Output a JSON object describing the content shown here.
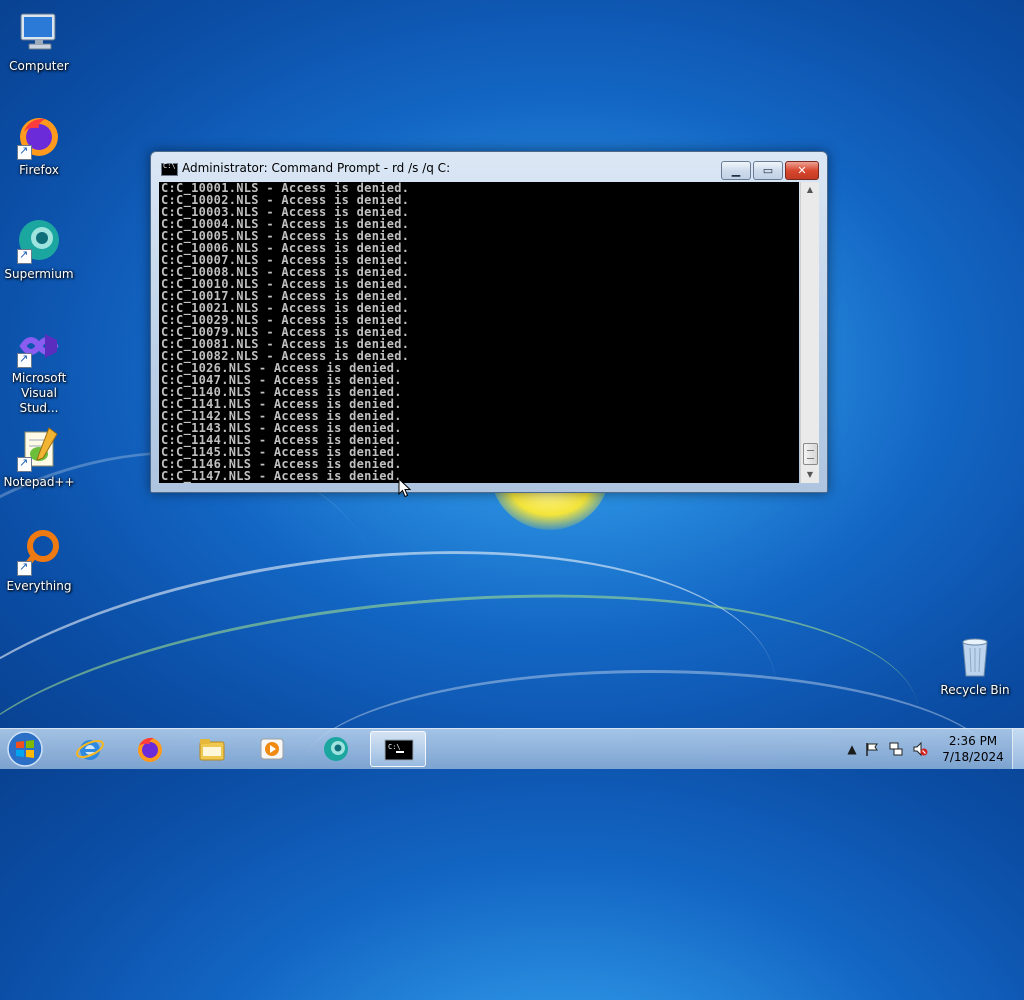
{
  "desktop": {
    "icons": [
      {
        "label": "Computer",
        "icon": "computer-icon"
      },
      {
        "label": "Firefox",
        "icon": "firefox-icon"
      },
      {
        "label": "Supermium",
        "icon": "supermium-icon"
      },
      {
        "label": "Microsoft Visual Stud...",
        "icon": "visual-studio-icon"
      },
      {
        "label": "Notepad++",
        "icon": "notepadpp-icon"
      },
      {
        "label": "Everything",
        "icon": "everything-icon"
      },
      {
        "label": "Recycle Bin",
        "icon": "recycle-bin-icon"
      }
    ]
  },
  "window": {
    "title": "Administrator:  Command Prompt - rd  /s /q C:",
    "icon": "cmd-icon",
    "buttons": {
      "minimize": "minimize-icon",
      "maximize": "maximize-icon",
      "close": "close-icon"
    },
    "console_lines": [
      "C:C_10001.NLS - Access is denied.",
      "C:C_10002.NLS - Access is denied.",
      "C:C_10003.NLS - Access is denied.",
      "C:C_10004.NLS - Access is denied.",
      "C:C_10005.NLS - Access is denied.",
      "C:C_10006.NLS - Access is denied.",
      "C:C_10007.NLS - Access is denied.",
      "C:C_10008.NLS - Access is denied.",
      "C:C_10010.NLS - Access is denied.",
      "C:C_10017.NLS - Access is denied.",
      "C:C_10021.NLS - Access is denied.",
      "C:C_10029.NLS - Access is denied.",
      "C:C_10079.NLS - Access is denied.",
      "C:C_10081.NLS - Access is denied.",
      "C:C_10082.NLS - Access is denied.",
      "C:C_1026.NLS - Access is denied.",
      "C:C_1047.NLS - Access is denied.",
      "C:C_1140.NLS - Access is denied.",
      "C:C_1141.NLS - Access is denied.",
      "C:C_1142.NLS - Access is denied.",
      "C:C_1143.NLS - Access is denied.",
      "C:C_1144.NLS - Access is denied.",
      "C:C_1145.NLS - Access is denied.",
      "C:C_1146.NLS - Access is denied.",
      "C:C_1147.NLS - Access is denied."
    ],
    "console_colors": {
      "background": "#000000",
      "text": "#c0c0c0"
    }
  },
  "taskbar": {
    "start": "windows-start-icon",
    "pinned": [
      {
        "name": "internet-explorer-icon"
      },
      {
        "name": "firefox-icon"
      },
      {
        "name": "file-explorer-icon"
      },
      {
        "name": "media-player-icon"
      },
      {
        "name": "supermium-icon"
      },
      {
        "name": "cmd-icon",
        "active": true
      }
    ],
    "tray": {
      "icons": [
        "show-hidden-icons-icon",
        "action-center-flag-icon",
        "network-icon",
        "volume-muted-icon"
      ],
      "time": "2:36 PM",
      "date": "7/18/2024"
    }
  }
}
